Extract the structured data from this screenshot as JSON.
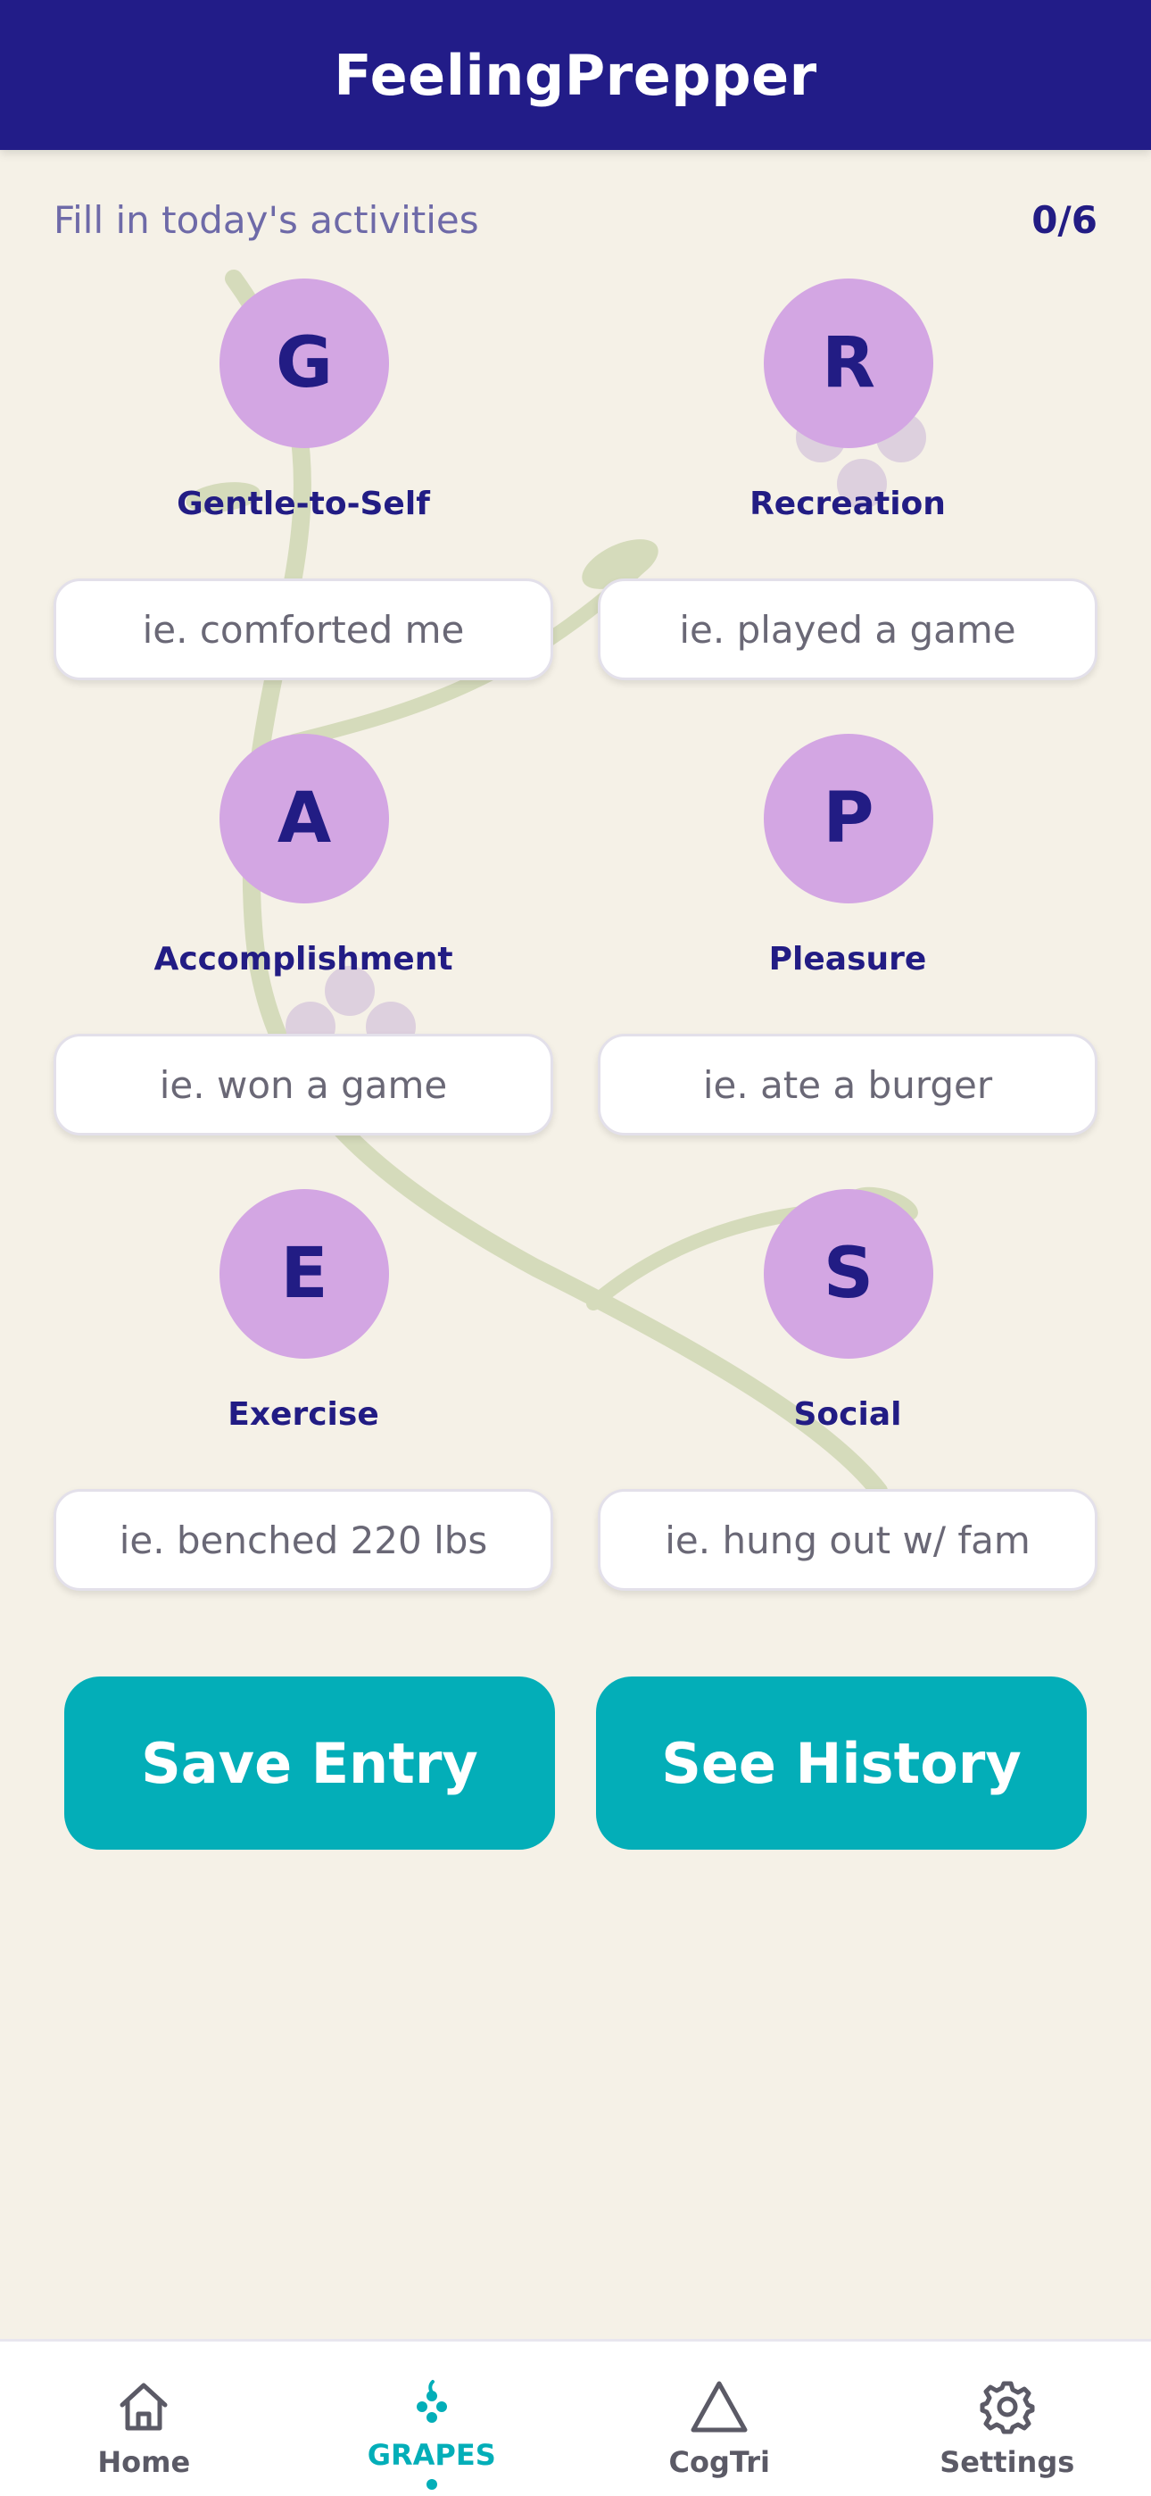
{
  "header": {
    "title": "FeelingPrepper"
  },
  "intro": {
    "prompt": "Fill in today's activities",
    "progress": "0/6"
  },
  "categories": [
    {
      "letter": "G",
      "label": "Gentle-to-Self",
      "placeholder": "ie. comforted me"
    },
    {
      "letter": "R",
      "label": "Recreation",
      "placeholder": "ie. played a game"
    },
    {
      "letter": "A",
      "label": "Accomplishment",
      "placeholder": "ie. won a game"
    },
    {
      "letter": "P",
      "label": "Pleasure",
      "placeholder": "ie. ate a burger"
    },
    {
      "letter": "E",
      "label": "Exercise",
      "placeholder": "ie. benched 220 lbs"
    },
    {
      "letter": "S",
      "label": "Social",
      "placeholder": "ie. hung out w/ fam"
    }
  ],
  "actions": {
    "save_label": "Save Entry",
    "history_label": "See History"
  },
  "tabs": [
    {
      "label": "Home",
      "icon": "home-icon"
    },
    {
      "label": "GRAPES",
      "icon": "grapes-icon",
      "active": true
    },
    {
      "label": "CogTri",
      "icon": "triangle-icon"
    },
    {
      "label": "Settings",
      "icon": "gear-icon"
    }
  ],
  "colors": {
    "header": "#221c88",
    "background": "#f5f1e7",
    "circle": "#d3a6e3",
    "accent": "#03aeb8",
    "text_dark": "#221c84"
  }
}
